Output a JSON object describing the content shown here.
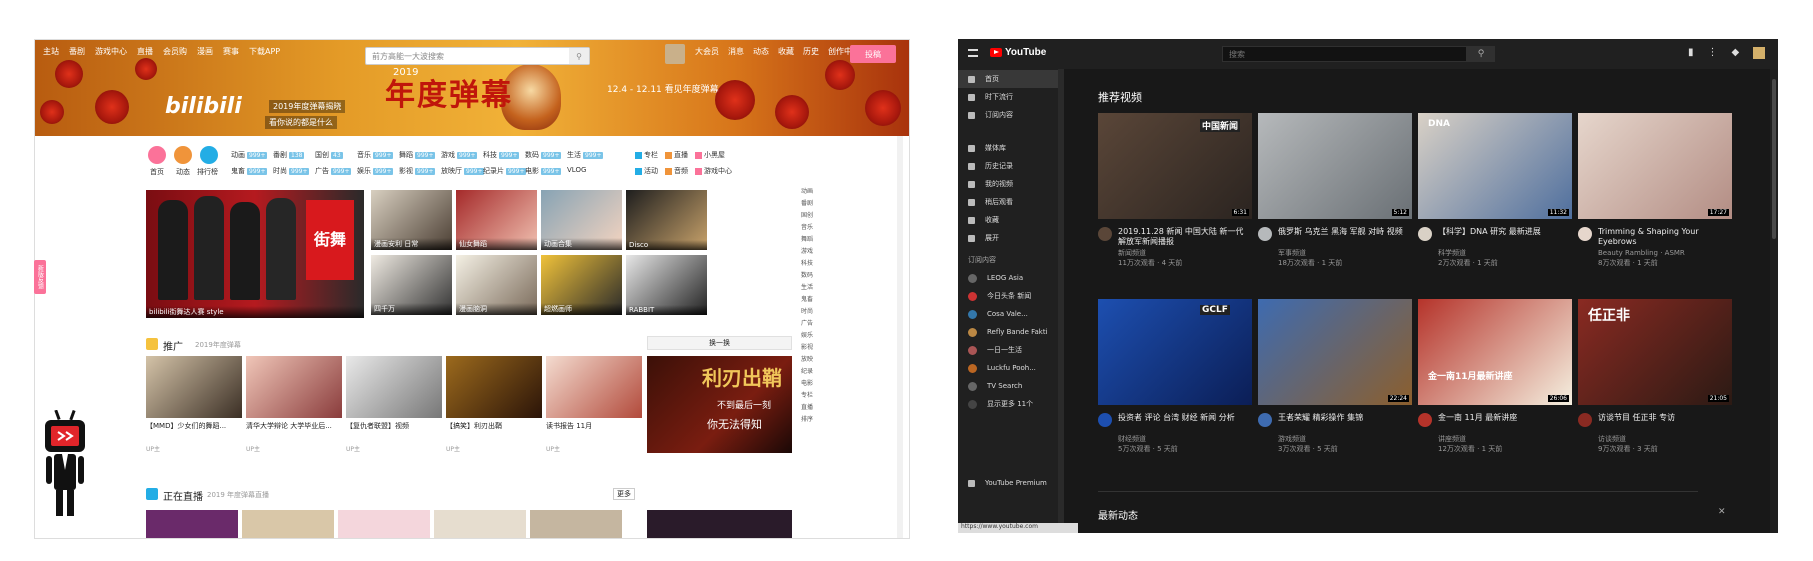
{
  "bili": {
    "nav": [
      "主站",
      "番剧",
      "游戏中心",
      "直播",
      "会员购",
      "漫画",
      "赛事",
      "下载APP"
    ],
    "search_placeholder": "前方高能一大波搜索",
    "user_links": [
      "大会员",
      "消息",
      "动态",
      "收藏",
      "历史",
      "创作中心"
    ],
    "upload_label": "投稿",
    "banner_year": "2019",
    "banner_title": "年度弹幕",
    "banner_logo": "bilibili",
    "banner_date": "12.4 - 12.11 看见年度弹幕",
    "banner_caption": "2019年度弹幕揭晓",
    "banner_caption2": "看你说的都是什么",
    "side_tab": "新版反馈",
    "cat_main": [
      {
        "label": "首页",
        "color": "#fb7299"
      },
      {
        "label": "动态",
        "color": "#f0943a"
      },
      {
        "label": "排行榜",
        "color": "#23ade5"
      }
    ],
    "cat_row1": [
      {
        "label": "动画",
        "n": "999+"
      },
      {
        "label": "番剧",
        "n": "138"
      },
      {
        "label": "国创",
        "n": "43"
      },
      {
        "label": "音乐",
        "n": "999+"
      },
      {
        "label": "舞蹈",
        "n": "999+"
      },
      {
        "label": "游戏",
        "n": "999+"
      },
      {
        "label": "科技",
        "n": "999+"
      },
      {
        "label": "数码",
        "n": "999+"
      },
      {
        "label": "生活",
        "n": "999+"
      }
    ],
    "cat_row2": [
      {
        "label": "鬼畜",
        "n": "999+"
      },
      {
        "label": "时尚",
        "n": "999+"
      },
      {
        "label": "广告",
        "n": "999+"
      },
      {
        "label": "娱乐",
        "n": "999+"
      },
      {
        "label": "影视",
        "n": "999+"
      },
      {
        "label": "放映厅",
        "n": "999+"
      },
      {
        "label": "纪录片",
        "n": "999+"
      },
      {
        "label": "电影",
        "n": "999+"
      },
      {
        "label": "VLOG",
        "n": ""
      }
    ],
    "cat_extra": [
      "专栏",
      "直播",
      "小黑屋",
      "活动",
      "音频",
      "游戏中心"
    ],
    "hero_caption": "bilibili街舞达人赛 style",
    "grid_captions": [
      "漫画安利 日常",
      "仙女舞蹈",
      "动画合集",
      "Disco",
      "四千万",
      "漫画脑洞",
      "超燃画师",
      "RABBIT"
    ],
    "promo_title": "推广",
    "promo_sub": "2019年度弹幕",
    "refresh_label": "换一换",
    "videos": [
      {
        "title": "【MMD】少女们的舞蹈...",
        "meta": "UP主"
      },
      {
        "title": "清华大学辩论 大学毕业后...",
        "meta": "UP主"
      },
      {
        "title": "【复仇者联盟】视频",
        "meta": "UP主"
      },
      {
        "title": "【搞笑】利刃出鞘",
        "meta": "UP主"
      },
      {
        "title": "读书报告 11月",
        "meta": "UP主"
      }
    ],
    "movie_text1": "利刃出鞘",
    "movie_text2": "不到最后一刻",
    "movie_text3": "你无法得知",
    "live_title": "正在直播",
    "live_sub": "2019 年度弹幕直播",
    "live_more": "更多",
    "rail": [
      "动画",
      "番剧",
      "国创",
      "音乐",
      "舞蹈",
      "游戏",
      "科技",
      "数码",
      "生活",
      "鬼畜",
      "时尚",
      "广告",
      "娱乐",
      "影视",
      "放映",
      "纪录",
      "电影",
      "专栏",
      "直播",
      "排序"
    ]
  },
  "yt": {
    "logo": "YouTube",
    "search_placeholder": "搜索",
    "section_title": "推荐视频",
    "bottom_title": "最新动态",
    "status_url": "https://www.youtube.com",
    "side_top": [
      {
        "label": "首页"
      },
      {
        "label": "时下流行"
      },
      {
        "label": "订阅内容"
      }
    ],
    "side_mid": [
      {
        "label": "媒体库"
      },
      {
        "label": "历史记录"
      },
      {
        "label": "我的视频"
      },
      {
        "label": "稍后观看"
      },
      {
        "label": "收藏"
      },
      {
        "label": "展开"
      }
    ],
    "side_sub_header": "订阅内容",
    "side_subs": [
      {
        "label": "LEOG Asia",
        "color": "#666"
      },
      {
        "label": "今日头条 新闻",
        "color": "#c33"
      },
      {
        "label": "Cosa Vale...",
        "color": "#37a"
      },
      {
        "label": "Refly Bande Fakti",
        "color": "#b84"
      },
      {
        "label": "一日一生活",
        "color": "#a55"
      },
      {
        "label": "Luckfu Pooh...",
        "color": "#b62"
      },
      {
        "label": "TV Search",
        "color": "#666"
      },
      {
        "label": "显示更多 11个",
        "color": "#444"
      }
    ],
    "side_bottom": "YouTube Premium",
    "videos": [
      {
        "title": "2019.11.28 新闻 中国大陆 新一代 解放军新闻播报",
        "channel": "新闻频道",
        "meta": "11万次观看 · 4 天前",
        "dur": "6:31",
        "tag": "中国新闻",
        "c1": "#5a4638",
        "c2": "#2b2420"
      },
      {
        "title": "俄罗斯 乌克兰 黑海 军舰 对峙 视频",
        "channel": "军事频道",
        "meta": "18万次观看 · 1 天前",
        "dur": "5:12",
        "tag": "",
        "c1": "#b6b9bb",
        "c2": "#6a7075"
      },
      {
        "title": "【科学】DNA 研究 最新进展",
        "channel": "科学频道",
        "meta": "2万次观看 · 1 天前",
        "dur": "11:32",
        "tag": "DNA",
        "c1": "#d9d1c6",
        "c2": "#4f6f9e"
      },
      {
        "title": "Trimming & Shaping Your Eyebrows",
        "channel": "Beauty Rambling · ASMR",
        "meta": "8万次观看 · 1 天前",
        "dur": "17:27",
        "tag": "",
        "c1": "#e6d6cc",
        "c2": "#b38d84"
      },
      {
        "title": "投资者 评论 台湾 财经 新闻 分析",
        "channel": "财经频道",
        "meta": "5万次观看 · 5 天前",
        "dur": "",
        "tag": "GCLF",
        "c1": "#1d4fb0",
        "c2": "#0b1e56"
      },
      {
        "title": "王者荣耀 精彩操作 集锦",
        "channel": "游戏频道",
        "meta": "3万次观看 · 5 天前",
        "dur": "22:24",
        "tag": "",
        "c1": "#3e6bb0",
        "c2": "#8c5f2d"
      },
      {
        "title": "金一南 11月 最新讲座",
        "channel": "讲座频道",
        "meta": "12万次观看 · 1 天前",
        "dur": "26:06",
        "tag": "金一南11月最新讲座",
        "c1": "#b5332a",
        "c2": "#f5f0e0"
      },
      {
        "title": "访谈节目 任正非 专访",
        "channel": "访谈频道",
        "meta": "9万次观看 · 3 天前",
        "dur": "21:05",
        "tag": "任正非",
        "c1": "#8a2a22",
        "c2": "#2b1a14"
      }
    ]
  }
}
